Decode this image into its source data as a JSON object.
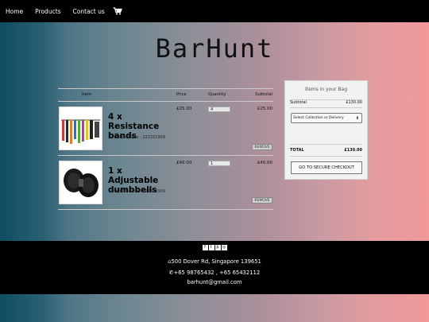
{
  "nav": {
    "home": "Home",
    "products": "Products",
    "contact": "Contact us",
    "cart_icon": "shopping-cart-icon"
  },
  "brand": {
    "title": "BarHunt"
  },
  "cart": {
    "headers": {
      "item": "Item",
      "price": "Price",
      "quantity": "Quantity",
      "subtotal": "Subtotal"
    },
    "rows": [
      {
        "name": "4 x Resistance bands",
        "code": "Product Code - 222321939",
        "price": "£25.00",
        "quantity": "4",
        "subtotal": "£25.00",
        "remove": "REMOVE"
      },
      {
        "name": "1 x Adjustable dumbbells",
        "code": "Product Code - 222321939",
        "price": "£40.00",
        "quantity": "1",
        "subtotal": "£40.00",
        "remove": "REMOVE"
      }
    ]
  },
  "bag": {
    "title": "Items in your Bag",
    "subtotal_label": "Subtotal",
    "subtotal_value": "£130.00",
    "delivery_select": "Select Collection or Delivery",
    "total_label": "TOTAL",
    "total_value": "£130.00",
    "checkout": "GO TO SECURE CHECKOUT"
  },
  "footer": {
    "social_icons": [
      "facebook-icon",
      "twitter-icon",
      "pinterest-icon",
      "instagram-icon"
    ],
    "address": "500 Dover Rd, Singapore 139651",
    "phone": "+65 98765432 , +65 65432112",
    "email": "barhunt@gmail.com"
  }
}
